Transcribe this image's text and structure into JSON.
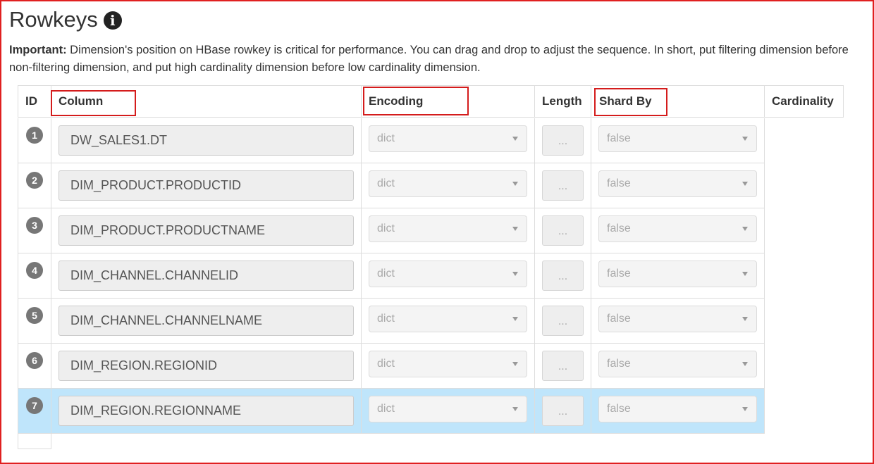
{
  "page": {
    "title": "Rowkeys",
    "note_label": "Important:",
    "note_text": " Dimension's position on HBase rowkey is critical for performance. You can drag and drop to adjust the sequence. In short, put filtering dimension before non-filtering dimension, and put high cardinality dimension before low cardinality dimension."
  },
  "table": {
    "headers": {
      "id": "ID",
      "column": "Column",
      "encoding": "Encoding",
      "length": "Length",
      "shard_by": "Shard By",
      "cardinality": "Cardinality"
    },
    "rows": [
      {
        "id": "1",
        "column": "DW_SALES1.DT",
        "encoding": "dict",
        "length": "...",
        "shard_by": "false"
      },
      {
        "id": "2",
        "column": "DIM_PRODUCT.PRODUCTID",
        "encoding": "dict",
        "length": "...",
        "shard_by": "false"
      },
      {
        "id": "3",
        "column": "DIM_PRODUCT.PRODUCTNAME",
        "encoding": "dict",
        "length": "...",
        "shard_by": "false"
      },
      {
        "id": "4",
        "column": "DIM_CHANNEL.CHANNELID",
        "encoding": "dict",
        "length": "...",
        "shard_by": "false"
      },
      {
        "id": "5",
        "column": "DIM_CHANNEL.CHANNELNAME",
        "encoding": "dict",
        "length": "...",
        "shard_by": "false"
      },
      {
        "id": "6",
        "column": "DIM_REGION.REGIONID",
        "encoding": "dict",
        "length": "...",
        "shard_by": "false"
      },
      {
        "id": "7",
        "column": "DIM_REGION.REGIONNAME",
        "encoding": "dict",
        "length": "...",
        "shard_by": "false",
        "selected": true
      }
    ]
  },
  "colors": {
    "selected_row": "#bfe5fb",
    "highlight_box": "#d41c1c",
    "frame": "#e02020",
    "badge": "#777777"
  }
}
